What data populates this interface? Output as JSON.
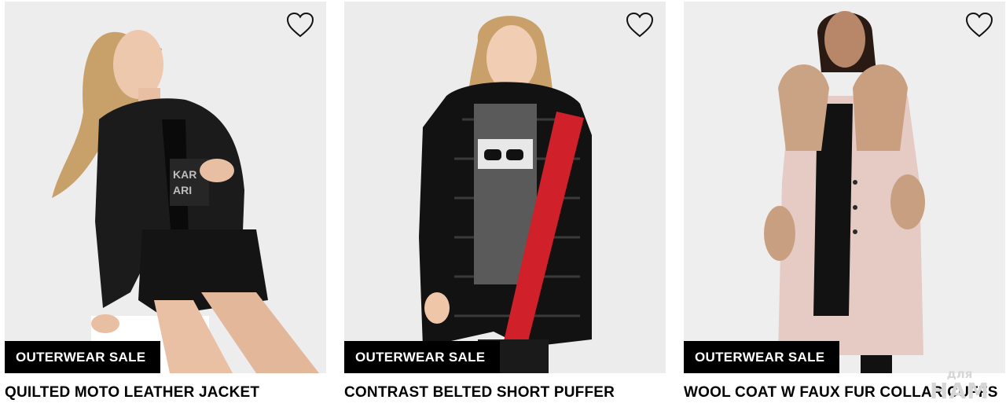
{
  "products": [
    {
      "badge": "OUTERWEAR SALE",
      "name": "QUILTED MOTO LEATHER JACKET",
      "wishlist_icon": "heart-outline-icon"
    },
    {
      "badge": "OUTERWEAR SALE",
      "name": "CONTRAST BELTED SHORT PUFFER",
      "wishlist_icon": "heart-outline-icon"
    },
    {
      "badge": "OUTERWEAR SALE",
      "name": "WOOL COAT W FAUX FUR COLLAR CUFFS",
      "wishlist_icon": "heart-outline-icon"
    }
  ],
  "watermark": {
    "top": "для",
    "bottom": "НАМ"
  },
  "colors": {
    "badge_bg": "#000000",
    "badge_text": "#ffffff",
    "photo_bg": "#eeeeee",
    "puffer_accent": "#d0202a",
    "coat_color": "#e6cbc4",
    "fur_color": "#caa384"
  }
}
